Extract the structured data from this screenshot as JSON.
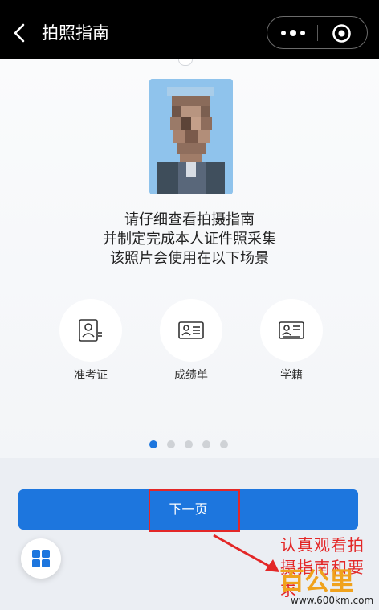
{
  "header": {
    "title": "拍照指南",
    "back_icon": "back-arrow-icon",
    "more_icon": "more-dots-icon",
    "close_icon": "close-target-icon"
  },
  "guide": {
    "instruction_lines": [
      "请仔细查看拍摄指南",
      "并制定完成本人证件照采集",
      "该照片会使用在以下场景"
    ],
    "scenes": [
      {
        "label": "准考证",
        "icon": "admission-ticket-icon"
      },
      {
        "label": "成绩单",
        "icon": "transcript-card-icon"
      },
      {
        "label": "学籍",
        "icon": "student-record-icon"
      }
    ],
    "pagination": {
      "total": 5,
      "active_index": 0
    }
  },
  "footer": {
    "next_label": "下一页",
    "menu_icon": "grid-menu-icon"
  },
  "annotation": {
    "text": "认真观看拍摄指南和要求",
    "color": "#e32727"
  },
  "watermark": {
    "brand": "百公里",
    "url": "www.600km.com"
  },
  "colors": {
    "accent": "#1d76de",
    "highlight": "#e32727",
    "header_bg": "#000000"
  }
}
